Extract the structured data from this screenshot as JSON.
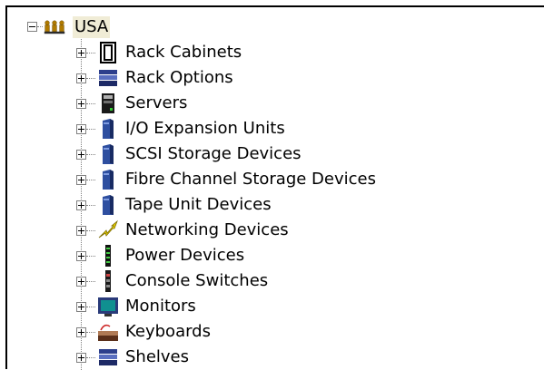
{
  "tree": {
    "root": {
      "label": "USA",
      "icon": "people-group-icon",
      "expanded": true
    },
    "children": [
      {
        "label": "Rack Cabinets",
        "icon": "rack-cabinet-icon"
      },
      {
        "label": "Rack Options",
        "icon": "rack-options-icon"
      },
      {
        "label": "Servers",
        "icon": "server-icon"
      },
      {
        "label": "I/O Expansion Units",
        "icon": "io-expansion-icon"
      },
      {
        "label": "SCSI Storage Devices",
        "icon": "scsi-storage-icon"
      },
      {
        "label": "Fibre Channel Storage Devices",
        "icon": "fibre-channel-storage-icon"
      },
      {
        "label": "Tape Unit Devices",
        "icon": "tape-unit-icon"
      },
      {
        "label": "Networking Devices",
        "icon": "networking-lightning-icon"
      },
      {
        "label": "Power Devices",
        "icon": "power-device-icon"
      },
      {
        "label": "Console Switches",
        "icon": "console-switch-icon"
      },
      {
        "label": "Monitors",
        "icon": "monitor-icon"
      },
      {
        "label": "Keyboards",
        "icon": "keyboard-icon"
      },
      {
        "label": "Shelves",
        "icon": "shelves-icon"
      }
    ]
  }
}
